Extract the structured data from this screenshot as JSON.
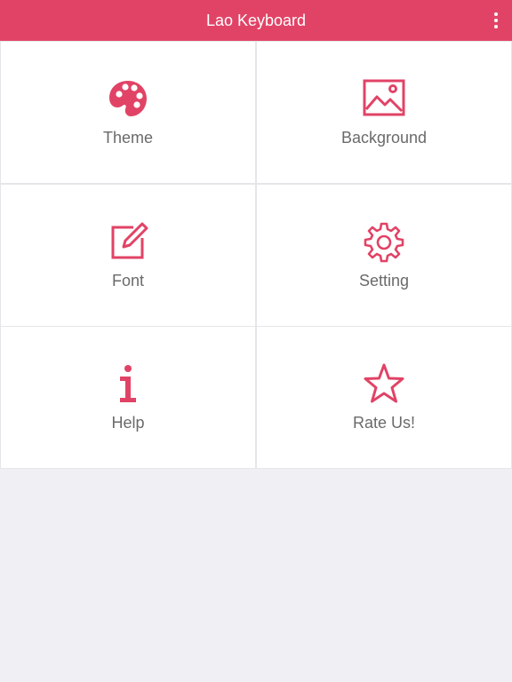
{
  "app_bar": {
    "title": "Lao Keyboard",
    "menu_icon": "more-vertical-icon",
    "color": "#e14366"
  },
  "accent_color": "#e14366",
  "tiles": [
    {
      "label": "Theme",
      "icon": "palette-icon"
    },
    {
      "label": "Background",
      "icon": "image-icon"
    },
    {
      "label": "Font",
      "icon": "edit-icon"
    },
    {
      "label": "Setting",
      "icon": "gear-icon"
    },
    {
      "label": "Help",
      "icon": "info-icon"
    },
    {
      "label": "Rate Us!",
      "icon": "star-icon"
    }
  ]
}
